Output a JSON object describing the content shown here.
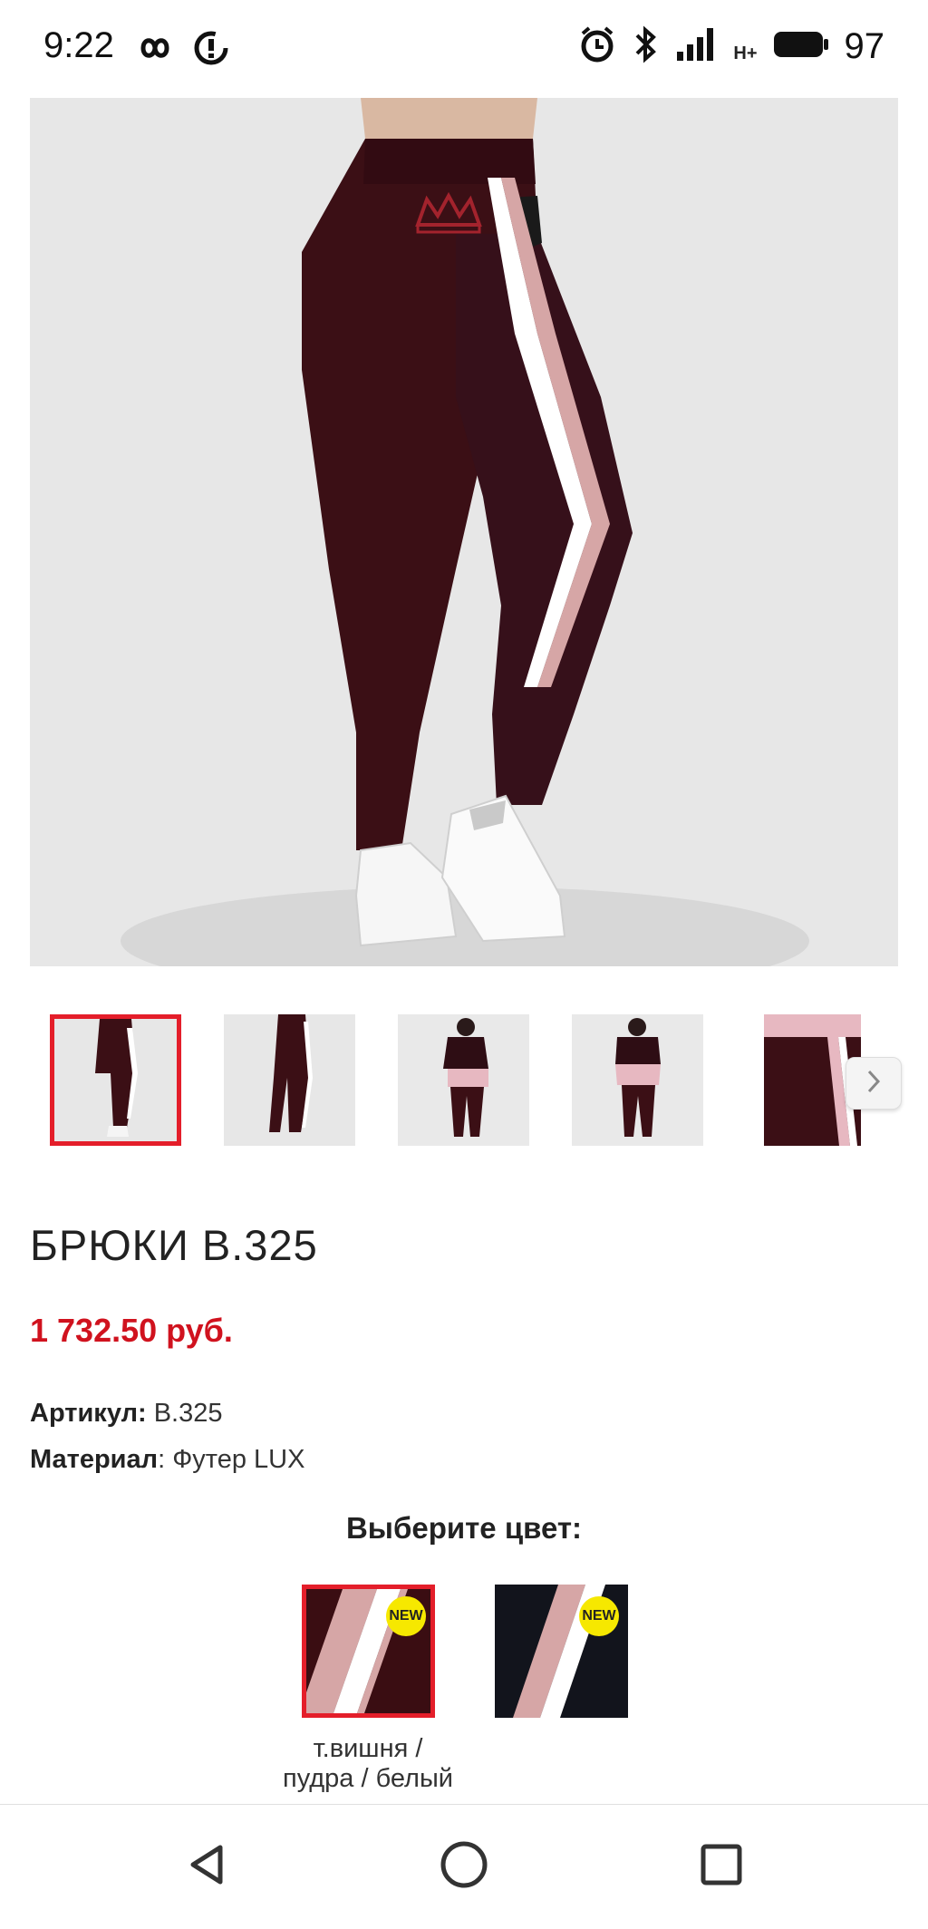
{
  "status_bar": {
    "time": "9:22",
    "battery": "97",
    "left_icons": [
      "infinity-icon",
      "data-saver-icon"
    ],
    "right_icons": [
      "alarm-icon",
      "bluetooth-icon",
      "signal-icon",
      "network-hplus-icon",
      "battery-icon"
    ],
    "network_label": "H+"
  },
  "gallery": {
    "main_image_alt": "pants-photo",
    "thumbnails": [
      "thumb-1",
      "thumb-2",
      "thumb-3",
      "thumb-4",
      "thumb-5"
    ],
    "selected_index": 0,
    "next_icon": "chevron-right-icon"
  },
  "product": {
    "title": "БРЮКИ B.325",
    "price": "1 732.50 руб.",
    "sku_label": "Артикул:",
    "sku_value": " B.325",
    "material_label": "Материал",
    "material_value": ": Футер LUX",
    "choose_color": "Выберите цвет:",
    "colors": [
      {
        "badge": "NEW",
        "label_line1": "т.вишня /",
        "label_line2": "пудра / белый",
        "base": "#3a0d12"
      },
      {
        "badge": "NEW",
        "base": "#12141c"
      }
    ]
  },
  "colors": {
    "accent_red": "#d0121e",
    "selection_border": "#e41e2a",
    "badge_yellow": "#f6e800",
    "pants_burgundy": "#3b0f15",
    "stripe_pink": "#d6a6a6"
  },
  "navbar": {
    "back": "back-icon",
    "home": "home-icon",
    "recents": "recents-icon"
  }
}
